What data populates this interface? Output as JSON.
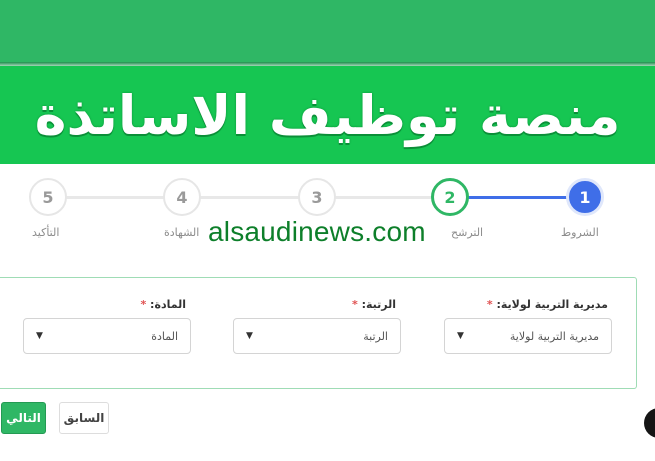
{
  "banner": {
    "title": "منصة توظيف الاساتذة"
  },
  "stepper": {
    "steps": [
      {
        "number": "1",
        "label": "الشروط",
        "state": "done"
      },
      {
        "number": "2",
        "label": "الترشح",
        "state": "current"
      },
      {
        "number": "3",
        "label": "",
        "state": "todo"
      },
      {
        "number": "4",
        "label": "الشهادة",
        "state": "todo"
      },
      {
        "number": "5",
        "label": "التأكيد",
        "state": "todo"
      }
    ]
  },
  "watermark": "alsaudinews.com",
  "form": {
    "fields": [
      {
        "label": "مديرية التربية لولاية:",
        "required_mark": "*",
        "value": "مديرية التربية لولاية"
      },
      {
        "label": "الرتبة:",
        "required_mark": "*",
        "value": "الرتبة"
      },
      {
        "label": "المادة:",
        "required_mark": "*",
        "value": "المادة"
      }
    ]
  },
  "actions": {
    "previous_label": "السابق",
    "next_label": "التالي"
  },
  "colors": {
    "brand_green": "#16c652",
    "accent_green": "#2fb765",
    "step_done_blue": "#3f6ee8"
  }
}
